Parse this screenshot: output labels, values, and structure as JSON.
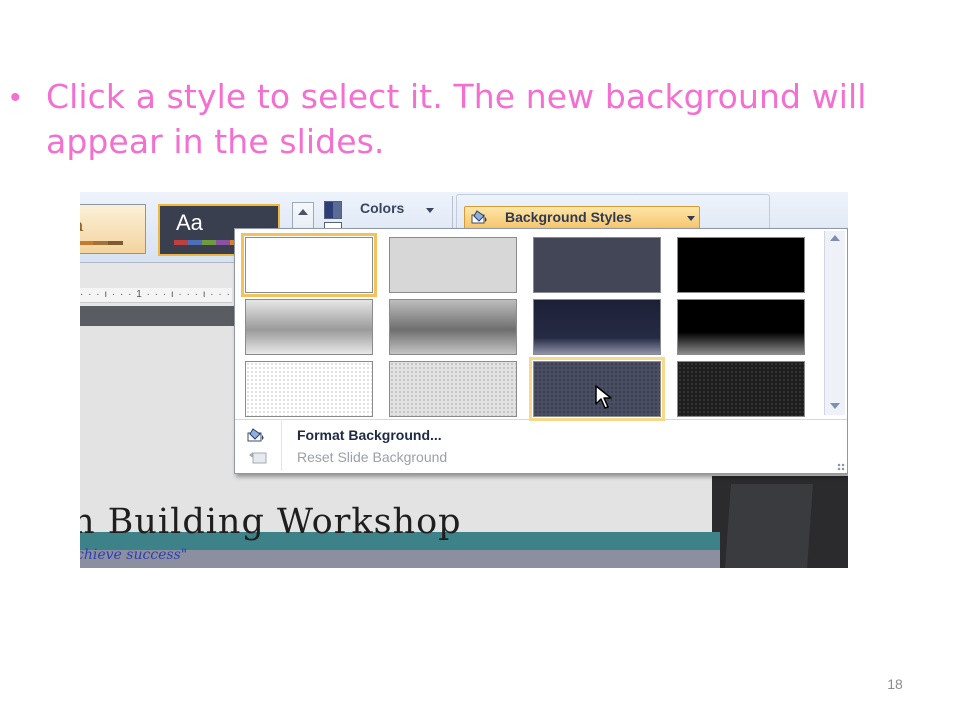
{
  "slide": {
    "bullet_text": "Click a style to select it. The new background will appear in the slides.",
    "page_number": "18"
  },
  "ribbon": {
    "theme_tile_a_text": "a",
    "theme_tile_b_text": "Aa",
    "colors_label": "Colors",
    "background_styles_label": "Background Styles"
  },
  "ruler_text": "· · · ı · · · 1 · · · ı · · · ı · · ·",
  "dropdown": {
    "tiles": [
      {
        "name": "style-1",
        "background": "#ffffff",
        "state": "selected"
      },
      {
        "name": "style-2",
        "background": "#d7d7d7",
        "state": "normal"
      },
      {
        "name": "style-3",
        "background": "#434657",
        "state": "normal"
      },
      {
        "name": "style-4",
        "background": "#000000",
        "state": "normal"
      },
      {
        "name": "style-5",
        "background": "gradient-gray-light",
        "state": "normal"
      },
      {
        "name": "style-6",
        "background": "gradient-gray-mid",
        "state": "normal"
      },
      {
        "name": "style-7",
        "background": "gradient-navy",
        "state": "normal"
      },
      {
        "name": "style-8",
        "background": "gradient-black",
        "state": "normal"
      },
      {
        "name": "style-9",
        "background": "texture-white",
        "state": "normal"
      },
      {
        "name": "style-10",
        "background": "texture-gray",
        "state": "normal"
      },
      {
        "name": "style-11",
        "background": "texture-slate",
        "state": "hovered"
      },
      {
        "name": "style-12",
        "background": "texture-black",
        "state": "normal"
      }
    ],
    "format_background_label": "Format Background...",
    "reset_background_label": "Reset Slide Background"
  },
  "slide_canvas": {
    "heading": "n Building Workshop",
    "tagline": "chieve success\""
  },
  "colors": {
    "bullet_pink": "#f36fd0",
    "selection_orange": "#f3c25c"
  }
}
